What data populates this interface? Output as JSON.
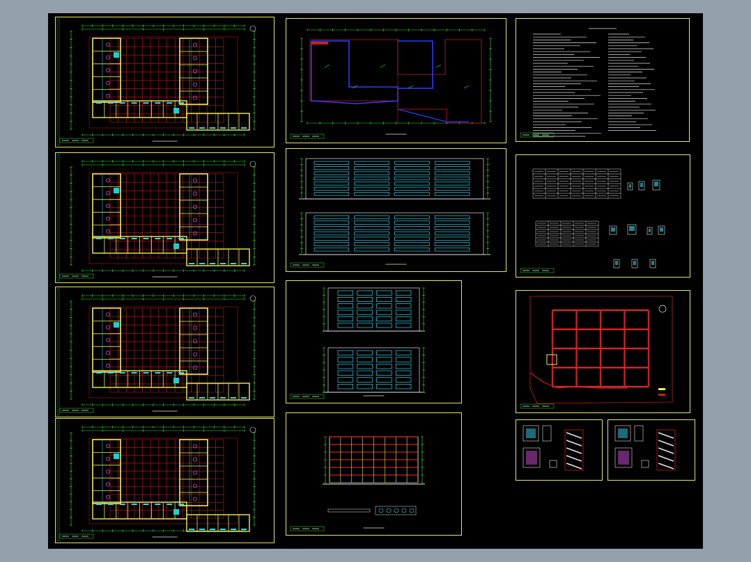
{
  "viewer": {
    "background_color": "#95a0ad",
    "canvas_color": "#000000",
    "frame_color": "#e8e86a"
  },
  "sheets": [
    {
      "id": "plan-1",
      "kind": "floor-plan"
    },
    {
      "id": "plan-2",
      "kind": "floor-plan"
    },
    {
      "id": "plan-3",
      "kind": "floor-plan"
    },
    {
      "id": "plan-4",
      "kind": "floor-plan"
    },
    {
      "id": "roof-plan",
      "kind": "roof-plan"
    },
    {
      "id": "elevations-1",
      "kind": "elevations"
    },
    {
      "id": "elevations-2",
      "kind": "elevations"
    },
    {
      "id": "section",
      "kind": "section"
    },
    {
      "id": "notes",
      "kind": "notes"
    },
    {
      "id": "schedule",
      "kind": "schedule"
    },
    {
      "id": "site-plan",
      "kind": "site-plan"
    },
    {
      "id": "stair-detail-1",
      "kind": "detail"
    },
    {
      "id": "stair-detail-2",
      "kind": "detail"
    }
  ],
  "colors": {
    "grid": "#cc1f1f",
    "walls": "#f2ef5a",
    "dims": "#33e63a",
    "windows": "#35d8f0",
    "fixtures": "#d14dd8",
    "outline": "#2a3dff",
    "white": "#e6e6e6"
  }
}
